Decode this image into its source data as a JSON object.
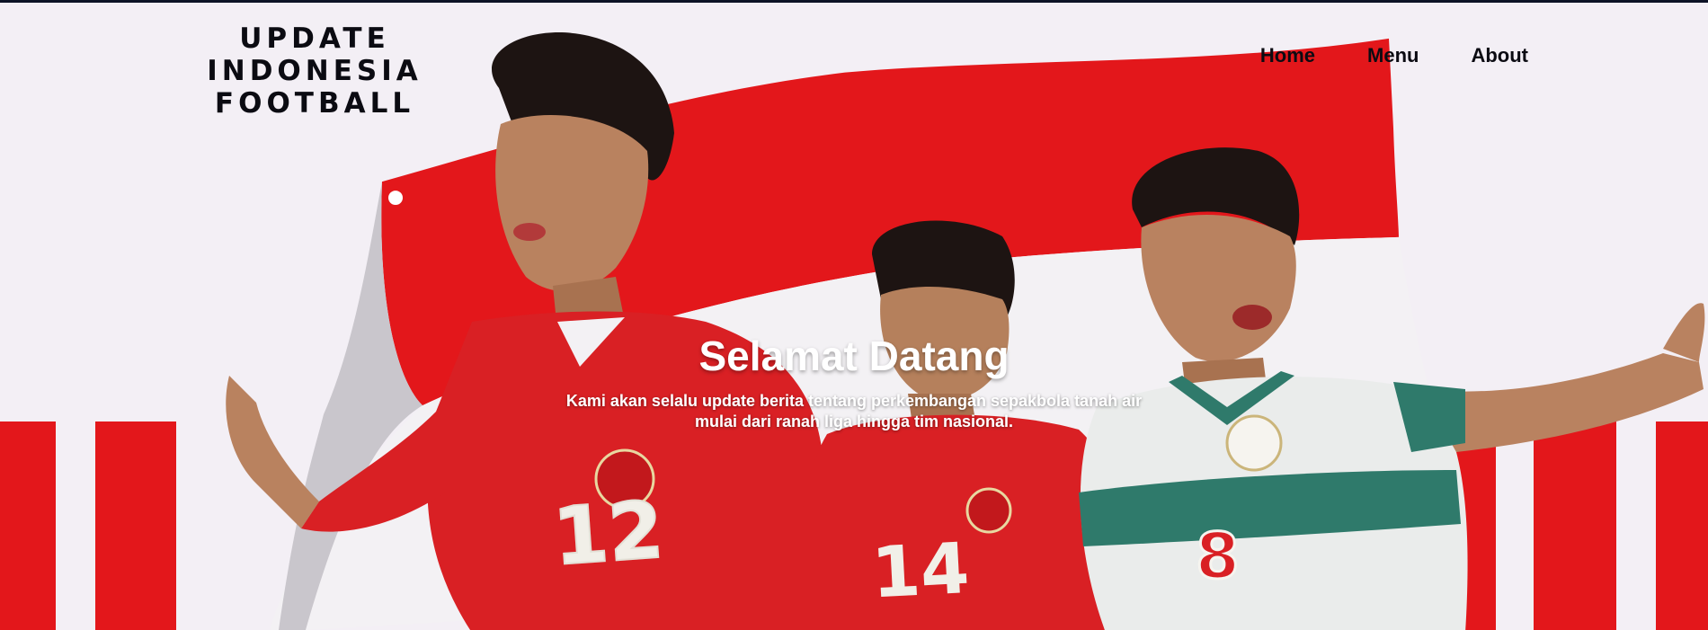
{
  "header": {
    "logo_line1": "UPDATE INDONESIA",
    "logo_line2": "FOOTBALL"
  },
  "nav": {
    "items": [
      "Home",
      "Menu",
      "About"
    ]
  },
  "hero": {
    "title": "Selamat Datang",
    "subtitle_line1": "Kami akan selalu update berita tentang perkembangan sepakbola tanah air",
    "subtitle_line2": "mulai dari ranah liga hingga tim nasional."
  },
  "players": [
    {
      "shirt_number": "12",
      "kit": "red"
    },
    {
      "shirt_number": "14",
      "kit": "red"
    },
    {
      "shirt_number": "8",
      "kit": "white"
    }
  ],
  "colors": {
    "flag_red": "#e3171b",
    "flag_white": "#f3f1f4",
    "kit_red": "#d92024",
    "kit_white": "#eaeceb",
    "kit_green": "#2f7a6b",
    "text_dark": "#0b0b12"
  }
}
